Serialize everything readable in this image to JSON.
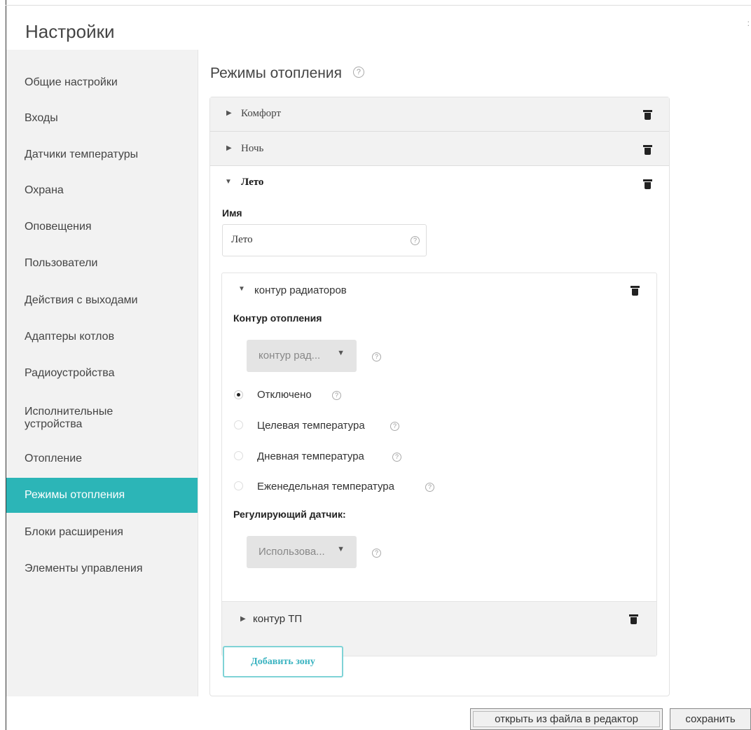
{
  "window": {
    "title": "Настройки"
  },
  "sidebar": {
    "items": [
      {
        "label": "Общие настройки",
        "active": false
      },
      {
        "label": "Входы",
        "active": false
      },
      {
        "label": "Датчики температуры",
        "active": false
      },
      {
        "label": "Охрана",
        "active": false
      },
      {
        "label": "Оповещения",
        "active": false
      },
      {
        "label": "Пользователи",
        "active": false
      },
      {
        "label": "Действия с выходами",
        "active": false
      },
      {
        "label": "Адаптеры котлов",
        "active": false
      },
      {
        "label": "Радиоустройства",
        "active": false
      },
      {
        "label": "Исполнительные устройства",
        "active": false
      },
      {
        "label": "Отопление",
        "active": false
      },
      {
        "label": "Режимы отопления",
        "active": true
      },
      {
        "label": "Блоки расширения",
        "active": false
      },
      {
        "label": "Элементы управления",
        "active": false
      }
    ],
    "accent_color": "#2cb5b7"
  },
  "main": {
    "title": "Режимы отопления",
    "help_icon": "?",
    "modes": [
      {
        "label": "Комфорт",
        "expanded": false
      },
      {
        "label": "Ночь",
        "expanded": false
      },
      {
        "label": "Лето",
        "expanded": true
      }
    ],
    "name_field": {
      "label": "Имя",
      "value": "Лето"
    },
    "zones": [
      {
        "label": "контур радиаторов",
        "expanded": true,
        "circuit_label": "Контур отопления",
        "circuit_select": "контур рад...",
        "radio_options": [
          {
            "label": "Отключено",
            "checked": true
          },
          {
            "label": "Целевая температура",
            "checked": false
          },
          {
            "label": "Дневная температура",
            "checked": false
          },
          {
            "label": "Еженедельная температура",
            "checked": false
          }
        ],
        "sensor_label": "Регулирующий датчик:",
        "sensor_select": "Использова..."
      },
      {
        "label": "контур ТП",
        "expanded": false
      }
    ],
    "add_zone_label": "Добавить зону"
  },
  "footer": {
    "open_from_file_label": "открыть из файла в редактор",
    "save_label": "сохранить"
  }
}
